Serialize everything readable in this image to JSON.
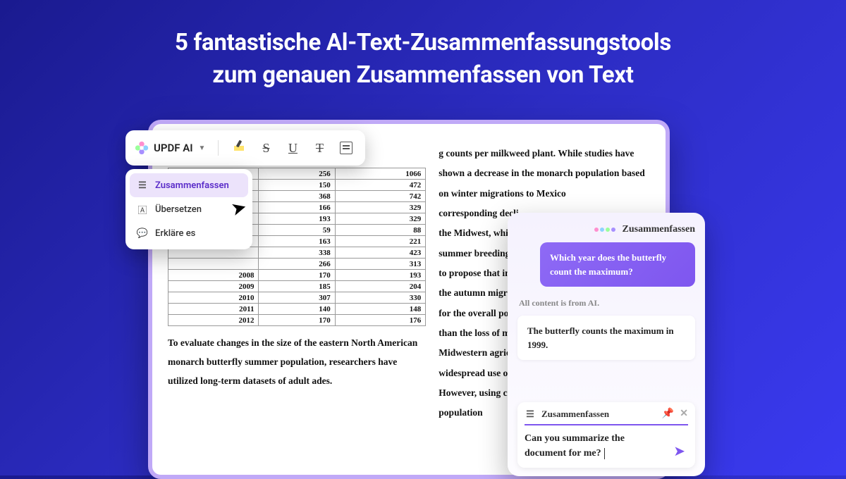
{
  "headline": {
    "line1": "5 fantastische Al-Text-Zusammenfassungstools",
    "line2": "zum genauen Zusammenfassen von Text"
  },
  "toolbar": {
    "brand": "UPDF AI"
  },
  "dropdown": {
    "items": [
      {
        "label": "Zusammenfassen"
      },
      {
        "label": "Übersetzen"
      },
      {
        "label": "Erkläre es"
      }
    ]
  },
  "chat": {
    "title": "Zusammenfassen",
    "user_msg": "Which year does the butterfly count the maximum?",
    "ai_note": "All content is from AI.",
    "ai_answer": "The butterfly counts the maximum in 1999.",
    "input_title": "Zusammenfassen",
    "input_text": "Can you summarize the document for me?"
  },
  "doc": {
    "para_left": "To evaluate changes in the size of the eastern North American monarch butterfly summer population, researchers have utilized long-term datasets of adult ades.",
    "para_right_top": "g counts per milkweed plant. While studies have shown a decrease in the monarch population based on winter migrations to Mexico",
    "para_right_lines": [
      "corresponding decli",
      "the Midwest, which f",
      "summer breeding ra",
      "to propose that incr",
      "the autumn migratio",
      "for the overall popul",
      "than the loss of milk",
      "Midwestern agricult",
      "widespread use of gl",
      "However, using coun",
      "population"
    ],
    "table": [
      {
        "c1": "256",
        "c2": "1066"
      },
      {
        "c1": "150",
        "c2": "472"
      },
      {
        "c1": "368",
        "c2": "742"
      },
      {
        "c1": "166",
        "c2": "329"
      },
      {
        "c1": "193",
        "c2": "329"
      },
      {
        "c1": "59",
        "c2": "88"
      },
      {
        "c1": "163",
        "c2": "221"
      },
      {
        "c1": "338",
        "c2": "423"
      },
      {
        "c1": "266",
        "c2": "313"
      },
      {
        "y": "2008",
        "c1": "170",
        "c2": "193"
      },
      {
        "y": "2009",
        "c1": "185",
        "c2": "204"
      },
      {
        "y": "2010",
        "c1": "307",
        "c2": "330"
      },
      {
        "y": "2011",
        "c1": "140",
        "c2": "148"
      },
      {
        "y": "2012",
        "c1": "170",
        "c2": "176"
      }
    ]
  }
}
